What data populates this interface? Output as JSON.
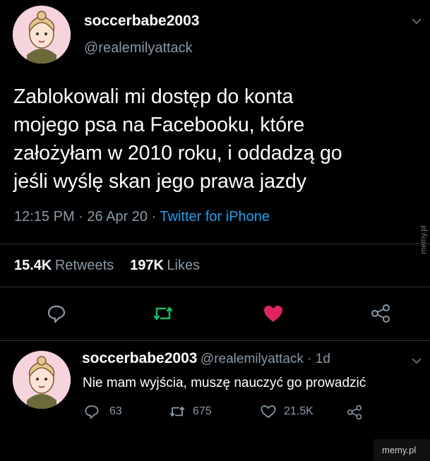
{
  "tweet": {
    "display_name": "soccerbabe2003",
    "handle": "@realemilyattack",
    "text_lines": [
      "Zablokowali mi dostęp do konta",
      "mojego psa na Facebooku, które",
      "założyłam w 2010 roku, i oddadzą go",
      "jeśli wyślę skan jego prawa jazdy"
    ],
    "timestamp": "12:15 PM · 26 Apr 20 · ",
    "source": "Twitter for iPhone",
    "retweets_count": "15.4K",
    "retweets_label": "Retweets",
    "likes_count": "197K",
    "likes_label": "Likes"
  },
  "reply": {
    "display_name": "soccerbabe2003",
    "handle": "@realemilyattack · 1d",
    "text": "Nie mam wyjścia, muszę nauczyć go prowadzić",
    "reply_count": "63",
    "retweet_count": "675",
    "like_count": "21.5K"
  },
  "watermarks": {
    "side": "memy.pl",
    "corner": "memy.pl"
  },
  "colors": {
    "accent": "#1da1f2",
    "retweet": "#17bf63",
    "like": "#e0245e",
    "muted": "#8899a6"
  },
  "icons": [
    "chevron-down-icon",
    "reply-icon",
    "retweet-icon",
    "heart-icon",
    "share-icon"
  ]
}
